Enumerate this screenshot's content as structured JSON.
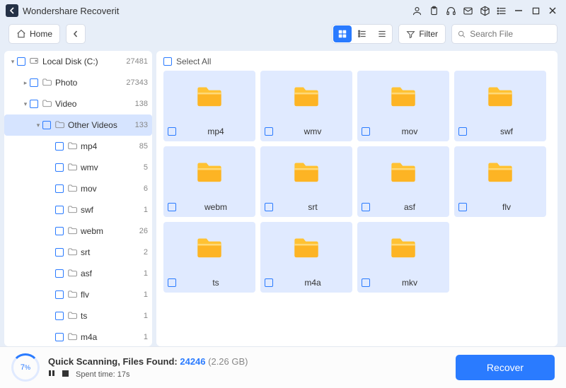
{
  "app_title": "Wondershare Recoverit",
  "toolbar": {
    "home": "Home",
    "filter": "Filter",
    "search_placeholder": "Search File"
  },
  "sidebar": {
    "items": [
      {
        "label": "Local Disk (C:)",
        "count": "27481",
        "depth": 0,
        "twisty": "▾",
        "icon": "disk",
        "sel": false
      },
      {
        "label": "Photo",
        "count": "27343",
        "depth": 1,
        "twisty": "▸",
        "icon": "folder",
        "sel": false
      },
      {
        "label": "Video",
        "count": "138",
        "depth": 1,
        "twisty": "▾",
        "icon": "folder",
        "sel": false
      },
      {
        "label": "Other Videos",
        "count": "133",
        "depth": 2,
        "twisty": "▾",
        "icon": "folder",
        "sel": true
      },
      {
        "label": "mp4",
        "count": "85",
        "depth": 3,
        "twisty": "",
        "icon": "folder",
        "sel": false
      },
      {
        "label": "wmv",
        "count": "5",
        "depth": 3,
        "twisty": "",
        "icon": "folder",
        "sel": false
      },
      {
        "label": "mov",
        "count": "6",
        "depth": 3,
        "twisty": "",
        "icon": "folder",
        "sel": false
      },
      {
        "label": "swf",
        "count": "1",
        "depth": 3,
        "twisty": "",
        "icon": "folder",
        "sel": false
      },
      {
        "label": "webm",
        "count": "26",
        "depth": 3,
        "twisty": "",
        "icon": "folder",
        "sel": false
      },
      {
        "label": "srt",
        "count": "2",
        "depth": 3,
        "twisty": "",
        "icon": "folder",
        "sel": false
      },
      {
        "label": "asf",
        "count": "1",
        "depth": 3,
        "twisty": "",
        "icon": "folder",
        "sel": false
      },
      {
        "label": "flv",
        "count": "1",
        "depth": 3,
        "twisty": "",
        "icon": "folder",
        "sel": false
      },
      {
        "label": "ts",
        "count": "1",
        "depth": 3,
        "twisty": "",
        "icon": "folder",
        "sel": false
      },
      {
        "label": "m4a",
        "count": "1",
        "depth": 3,
        "twisty": "",
        "icon": "folder",
        "sel": false
      }
    ]
  },
  "grid": {
    "select_all": "Select All",
    "tiles": [
      {
        "name": "mp4"
      },
      {
        "name": "wmv"
      },
      {
        "name": "mov"
      },
      {
        "name": "swf"
      },
      {
        "name": "webm"
      },
      {
        "name": "srt"
      },
      {
        "name": "asf"
      },
      {
        "name": "flv"
      },
      {
        "name": "ts"
      },
      {
        "name": "m4a"
      },
      {
        "name": "mkv"
      }
    ]
  },
  "status": {
    "progress_pct": "7",
    "pct_suffix": "%",
    "scan_label": "Quick Scanning, Files Found: ",
    "files_found": "24246",
    "size": "(2.26 GB)",
    "spent_label": "Spent time:",
    "spent_time": "17s",
    "recover": "Recover"
  }
}
